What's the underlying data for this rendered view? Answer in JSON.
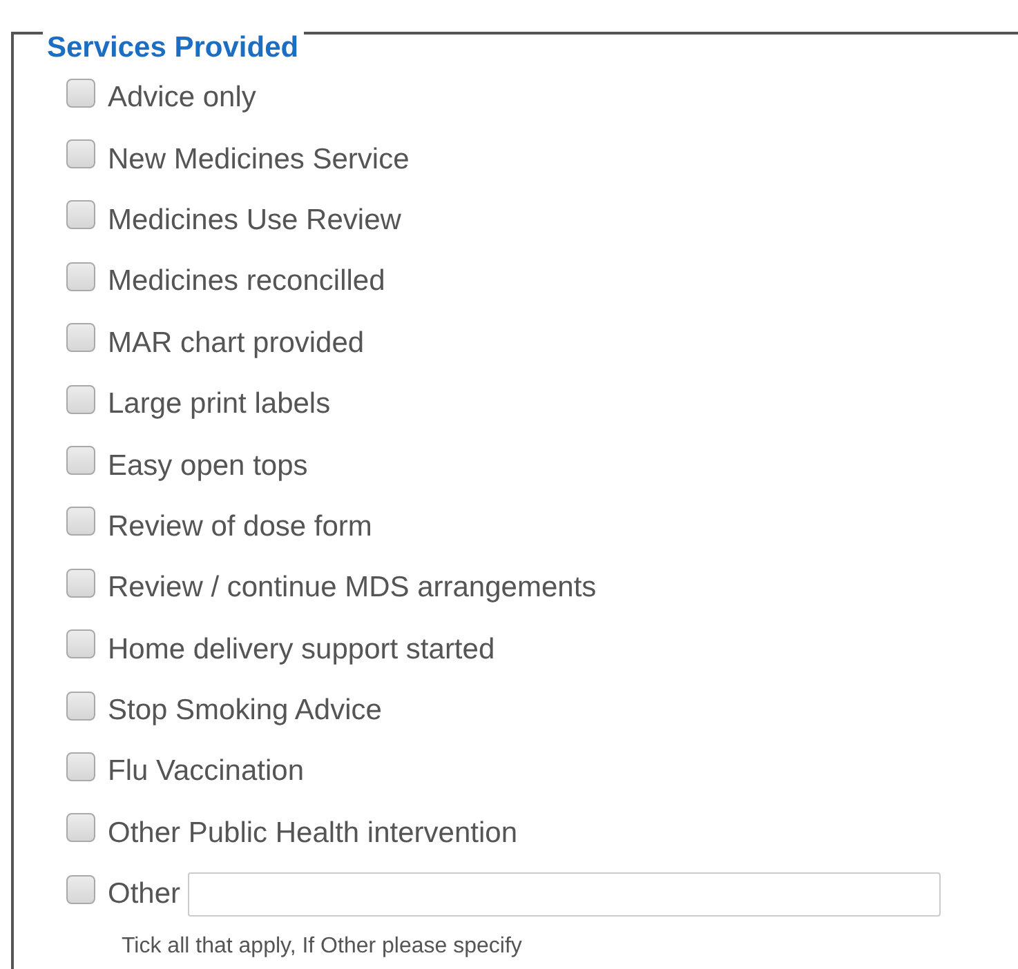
{
  "fieldset": {
    "legend": "Services Provided",
    "items": [
      {
        "kind": "checkbox",
        "label": "Advice only",
        "checked": false
      },
      {
        "kind": "checkbox",
        "label": "New Medicines Service",
        "checked": false
      },
      {
        "kind": "checkbox",
        "label": "Medicines Use Review",
        "checked": false
      },
      {
        "kind": "checkbox",
        "label": "Medicines reconcilled",
        "checked": false
      },
      {
        "kind": "checkbox",
        "label": "MAR chart provided",
        "checked": false
      },
      {
        "kind": "checkbox",
        "label": "Large print labels",
        "checked": false
      },
      {
        "kind": "checkbox",
        "label": "Easy open tops",
        "checked": false
      },
      {
        "kind": "checkbox",
        "label": "Review of dose form",
        "checked": false
      },
      {
        "kind": "checkbox",
        "label": "Review / continue MDS arrangements",
        "checked": false
      },
      {
        "kind": "checkbox",
        "label": "Home delivery support started",
        "checked": false
      },
      {
        "kind": "checkbox",
        "label": "Stop Smoking Advice",
        "checked": false
      },
      {
        "kind": "checkbox",
        "label": "Flu Vaccination",
        "checked": false
      },
      {
        "kind": "checkbox",
        "label": "Other Public Health intervention",
        "checked": false
      },
      {
        "kind": "checkbox-with-field",
        "label": "Other",
        "checked": false
      }
    ],
    "help_text": "Tick all that apply, If Other please specify"
  }
}
